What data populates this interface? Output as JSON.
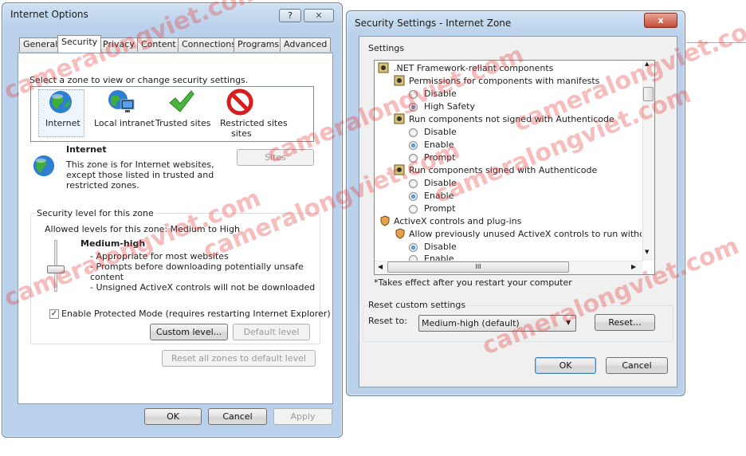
{
  "internet_options": {
    "title": "Internet Options",
    "help_btn": "?",
    "tabs": [
      "General",
      "Security",
      "Privacy",
      "Content",
      "Connections",
      "Programs",
      "Advanced"
    ],
    "zone_prompt": "Select a zone to view or change security settings.",
    "zones": [
      "Internet",
      "Local intranet",
      "Trusted sites",
      "Restricted sites"
    ],
    "restricted_line2": "sites",
    "zone_name": "Internet",
    "zone_desc": [
      "This zone is for Internet websites,",
      "except those listed in trusted and",
      "restricted zones."
    ],
    "sites_btn": "Sites",
    "security_level_title": "Security level for this zone",
    "allowed_levels": "Allowed levels for this zone: Medium to High",
    "level_name": "Medium-high",
    "level_points": [
      "- Appropriate for most websites",
      "- Prompts before downloading potentially unsafe",
      "content",
      "- Unsigned ActiveX controls will not be downloaded"
    ],
    "protected_mode": "Enable Protected Mode (requires restarting Internet Explorer)",
    "custom_level_btn": "Custom level...",
    "default_level_btn": "Default level",
    "reset_all_btn": "Reset all zones to default level",
    "ok_btn": "OK",
    "cancel_btn": "Cancel",
    "apply_btn": "Apply"
  },
  "security_settings": {
    "title": "Security Settings - Internet Zone",
    "close_glyph": "x",
    "settings_label": "Settings",
    "tree": [
      ".NET Framework-reliant components",
      "Permissions for components with manifests",
      "Disable",
      "High Safety",
      "Run components not signed with Authenticode",
      "Disable",
      "Enable",
      "Prompt",
      "Run components signed with Authenticode",
      "Disable",
      "Enable",
      "Prompt",
      "ActiveX controls and plug-ins",
      "Allow previously unused ActiveX controls to run without prom",
      "Disable",
      "Enable"
    ],
    "hscroll_grip": "III",
    "restart_note": "*Takes effect after you restart your computer",
    "reset_title": "Reset custom settings",
    "reset_to_label": "Reset to:",
    "reset_select": "Medium-high (default)",
    "reset_btn": "Reset...",
    "ok_btn": "OK",
    "cancel_btn": "Cancel"
  },
  "watermark": "cameralongviet.com"
}
